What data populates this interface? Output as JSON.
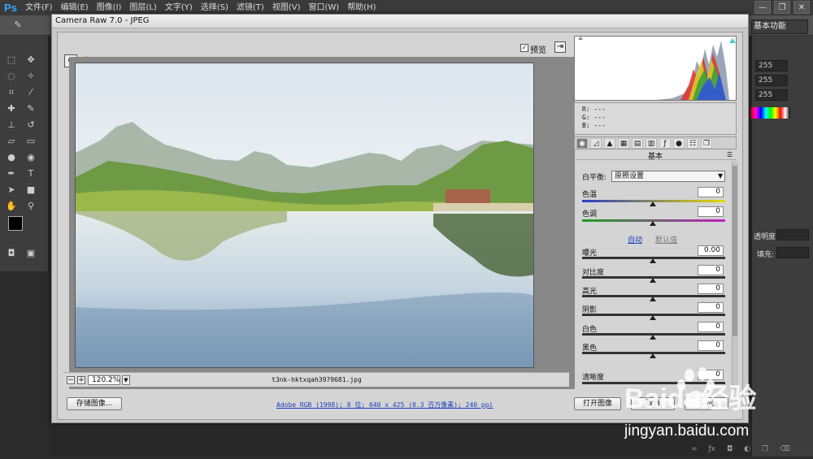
{
  "app": {
    "logo": "Ps",
    "menu": [
      "文件(F)",
      "编辑(E)",
      "图像(I)",
      "图层(L)",
      "文字(Y)",
      "选择(S)",
      "滤镜(T)",
      "视图(V)",
      "窗口(W)",
      "帮助(H)"
    ],
    "window_buttons": [
      "—",
      "❐",
      "✕"
    ],
    "workspace": "基本功能"
  },
  "right_panel": {
    "values": [
      "255",
      "255",
      "255"
    ],
    "opacity_label": "透明度:",
    "fill_label": "填充:"
  },
  "dialog": {
    "title": "Camera Raw 7.0 -  JPEG",
    "preview_label": "预览",
    "preview_checked": "✓",
    "zoom_level": "120.2%",
    "filename": "t3nk-hktxqah3979681.jpg",
    "rgb": {
      "r": "R:  ---",
      "g": "G:  ---",
      "b": "B:  ---"
    },
    "panel_title": "基本",
    "white_balance": {
      "label": "白平衡:",
      "value": "原照设置"
    },
    "controls": [
      {
        "label": "色温",
        "value": "0"
      },
      {
        "label": "色调",
        "value": "0"
      },
      {
        "label": "曝光",
        "value": "0.00"
      },
      {
        "label": "对比度",
        "value": "0"
      },
      {
        "label": "高光",
        "value": "0"
      },
      {
        "label": "阴影",
        "value": "0"
      },
      {
        "label": "白色",
        "value": "0"
      },
      {
        "label": "黑色",
        "value": "0"
      },
      {
        "label": "清晰度",
        "value": "0"
      }
    ],
    "auto_label": "自动",
    "default_label": "默认值",
    "workflow": "Adobe RGB (1998); 8 位; 640 x 425 (0.3 百万像素); 240 ppi",
    "buttons": {
      "save": "存储图像...",
      "open": "打开图像",
      "cancel": "取消",
      "done": "完成"
    }
  },
  "watermark": {
    "brand": "Baidu经验",
    "url": "jingyan.baidu.com"
  }
}
